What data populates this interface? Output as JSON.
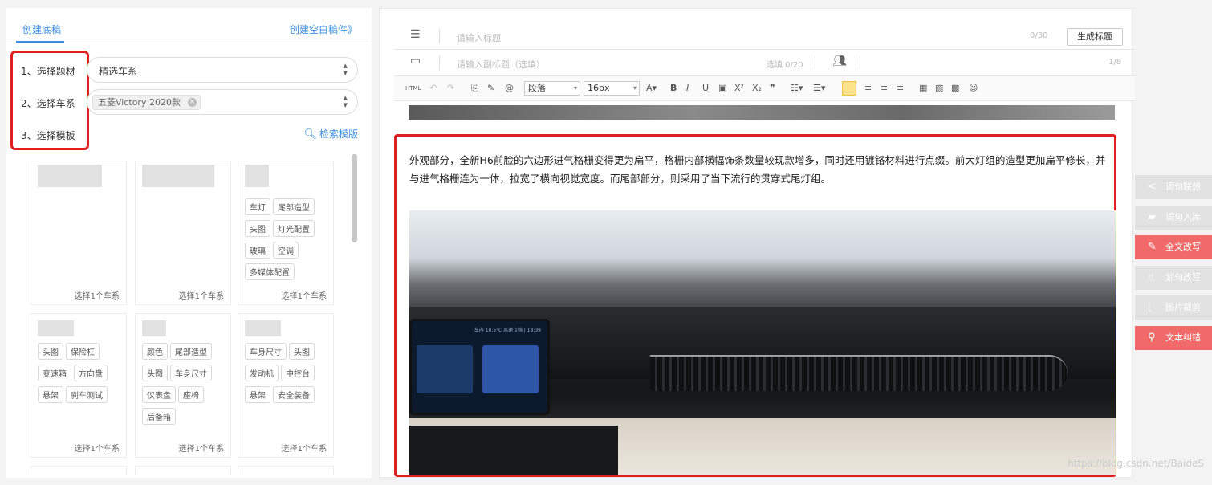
{
  "left_panel": {
    "tab_active": "创建底稿",
    "tab_right": "创建空白稿件》",
    "steps": [
      "1、选择题材",
      "2、选择车系",
      "3、选择模板"
    ],
    "select_series_placeholder": "精选车系",
    "selected_chip": "五菱Victory 2020款",
    "search_template": "检索模版",
    "card_footer": "选择1个车系",
    "card_rows": [
      [
        {
          "tags": []
        },
        {
          "tags": []
        },
        {
          "tags": [
            "车灯",
            "尾部造型",
            "头图",
            "灯光配置",
            "玻璃",
            "空调",
            "多媒体配置"
          ]
        }
      ],
      [
        {
          "tags": [
            "头图",
            "保险杠",
            "变速箱",
            "方向盘",
            "悬架",
            "刹车测试"
          ]
        },
        {
          "tags": [
            "颜色",
            "尾部造型",
            "头图",
            "车身尺寸",
            "仪表盘",
            "座椅",
            "后备箱"
          ]
        },
        {
          "tags": [
            "车身尺寸",
            "头图",
            "发动机",
            "中控台",
            "悬架",
            "安全装备"
          ]
        }
      ]
    ]
  },
  "editor": {
    "title_placeholder": "请输入标题",
    "title_counter": "0/30",
    "generate_button": "生成标题",
    "subtitle_placeholder": "请输入副标题（选填）",
    "subtitle_counter": "选填 0/20",
    "page_counter": "1/8",
    "toolbar": {
      "html": "HTML",
      "paragraph": "段落",
      "fontsize": "16px"
    },
    "paragraph_text": "外观部分，全新H6前脸的六边形进气格栅变得更为扁平，格栅内部横幅饰条数量较现款增多，同时还用镀铬材料进行点缀。前大灯组的造型更加扁平修长，并与进气格栅连为一体，拉宽了横向视觉宽度。而尾部部分，则采用了当下流行的贯穿式尾灯组。",
    "photo_screen_status": "车内 18.5°C 风速 1档 | 18:39"
  },
  "right_tools": [
    {
      "label": "词句联想",
      "icon": "share-icon",
      "style": "gray"
    },
    {
      "label": "词句入库",
      "icon": "inbox-icon",
      "style": "gray"
    },
    {
      "label": "全文改写",
      "icon": "pencil-icon",
      "style": "red"
    },
    {
      "label": "划句改写",
      "icon": "pointer-icon",
      "style": "gray"
    },
    {
      "label": "图片裁剪",
      "icon": "crop-icon",
      "style": "gray"
    },
    {
      "label": "文本纠错",
      "icon": "search-icon",
      "style": "red"
    }
  ],
  "watermark": "https://blog.csdn.net/BaideS",
  "colors": {
    "accent": "#3a8ee6",
    "highlight_red": "#e02020",
    "tool_red": "#f06a6a"
  }
}
